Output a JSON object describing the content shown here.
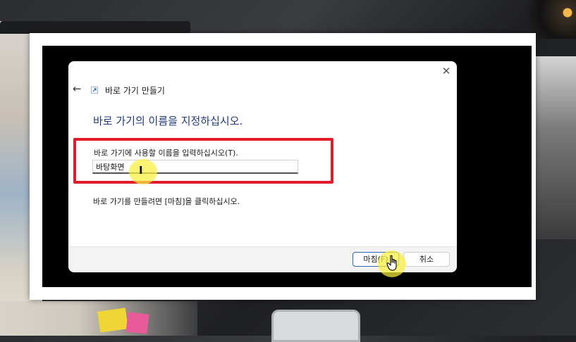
{
  "dialog": {
    "window_title": "바로 가기 만들기",
    "heading": "바로 가기의 이름을 지정하십시오.",
    "field_label": "바로 가기에 사용할 이름을 입력하십시오(T).",
    "name_value": "바탕화면",
    "info_text": "바로 가기를 만들려면 [마침]을 클릭하십시오.",
    "close_glyph": "✕",
    "back_glyph": "←"
  },
  "buttons": {
    "finish_label": "마침(F)",
    "cancel_label": "취소"
  },
  "annotations": {
    "highlight_color": "#e31c2a",
    "cursor_highlight_color": "#f8f03c"
  },
  "icons": [
    "back-arrow-icon",
    "shortcut-icon",
    "close-icon",
    "text-cursor-icon",
    "hand-pointer-icon"
  ]
}
